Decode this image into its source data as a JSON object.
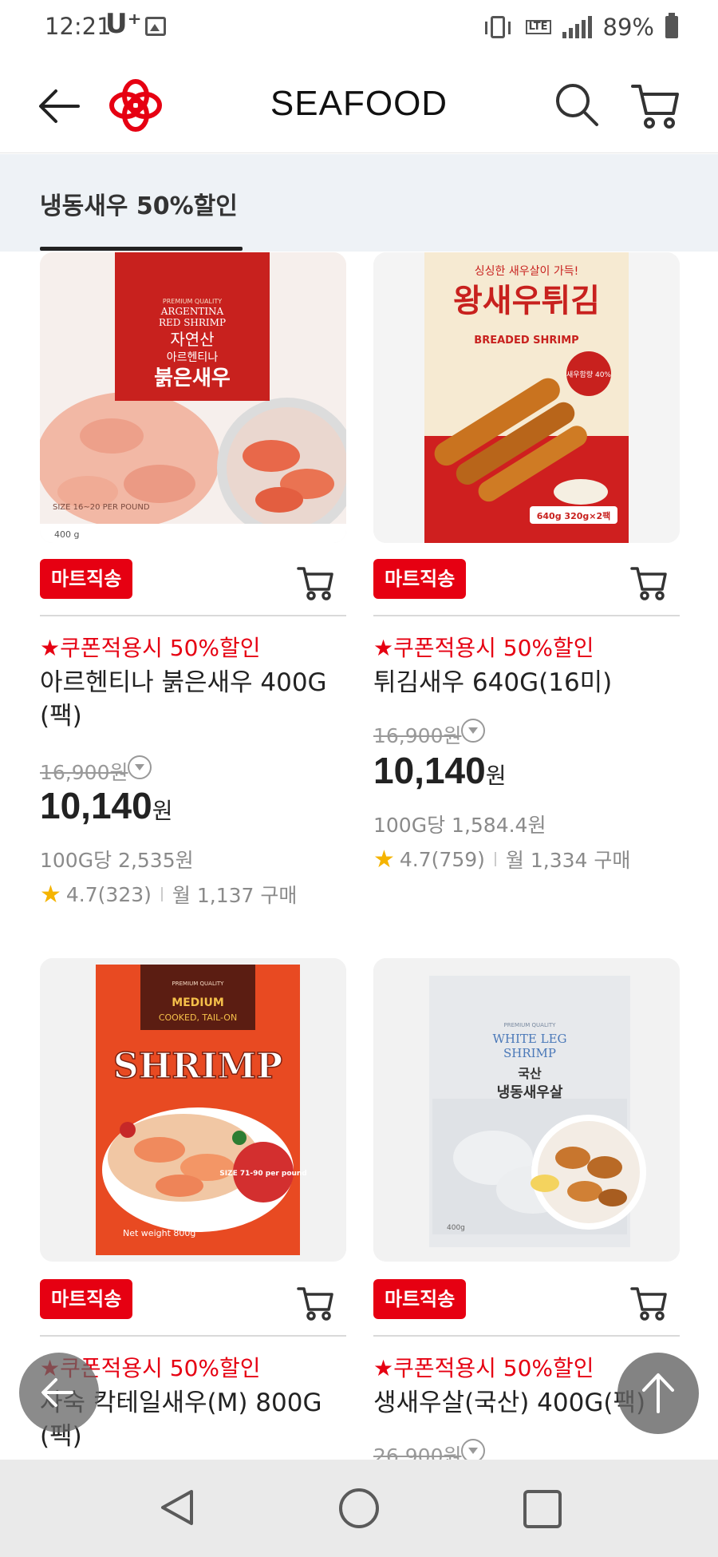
{
  "status_bar": {
    "time": "12:21",
    "carrier": "U⁺",
    "battery": "89%",
    "icons": [
      "image-icon",
      "vibrate-icon",
      "lte-icon",
      "signal-icon",
      "battery-icon"
    ]
  },
  "header": {
    "title": "SEAFOOD",
    "icons": [
      "back-arrow-icon",
      "brand-logo",
      "search-icon",
      "cart-icon"
    ],
    "brand_color": "#e60012"
  },
  "tabs": [
    {
      "label": "냉동새우 50%할인",
      "active": true
    }
  ],
  "products": [
    {
      "image_text": [
        "PREMIUM QUALITY",
        "ARGENTINA",
        "RED SHRIMP",
        "자연산",
        "아르헨티나",
        "붉은새우",
        "SIZE 16~20 PER POUND",
        "400 g"
      ],
      "badge": "마트직송",
      "coupon": "★쿠폰적용시 50%할인",
      "name": "아르헨티나 붉은새우 400G (팩)",
      "original_price": "16,900원",
      "sale_price": "10,140",
      "sale_unit": "원",
      "unit_price": "100G당 2,535원",
      "rating": "4.7(323)",
      "monthly": "월 1,137 구매"
    },
    {
      "image_text": [
        "싱싱한 새우살이 가득!",
        "왕새우튀김",
        "BREADED SHRIMP",
        "새우함량 40%",
        "640g 320g×2팩"
      ],
      "badge": "마트직송",
      "coupon": "★쿠폰적용시 50%할인",
      "name": "튀김새우 640G(16미)",
      "original_price": "16,900원",
      "sale_price": "10,140",
      "sale_unit": "원",
      "unit_price": "100G당 1,584.4원",
      "rating": "4.7(759)",
      "monthly": "월 1,334 구매"
    },
    {
      "image_text": [
        "PREMIUM QUALITY",
        "MEDIUM",
        "COOKED, TAIL-ON",
        "SHRIMP",
        "SIZE 71-90 per pound",
        "Net weight 800g"
      ],
      "badge": "마트직송",
      "coupon": "★쿠폰적용시 50%할인",
      "name": "자숙 칵테일새우(M) 800G (팩)"
    },
    {
      "image_text": [
        "PREMIUM QUALITY",
        "WHITE LEG",
        "SHRIMP",
        "국산",
        "냉동새우살",
        "400g"
      ],
      "badge": "마트직송",
      "coupon": "★쿠폰적용시 50%할인",
      "name": "생새우살(국산) 400G(팩)",
      "original_price": "26,900원"
    }
  ],
  "floating": {
    "back_icon": "back-arrow-icon",
    "top_icon": "arrow-up-icon"
  },
  "nav_bar": {
    "icons": [
      "nav-back-icon",
      "nav-home-icon",
      "nav-recent-icon"
    ]
  }
}
